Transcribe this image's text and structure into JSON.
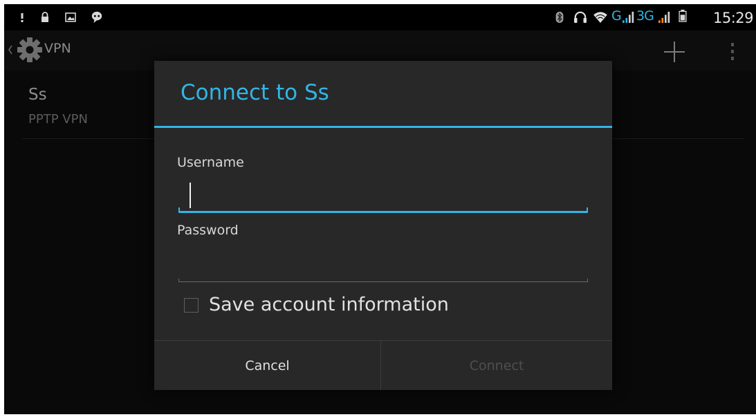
{
  "status_bar": {
    "time": "15:29",
    "network_g": "G",
    "network_3g": "3G",
    "icons": [
      "alert-icon",
      "lock-icon",
      "image-icon",
      "talk-icon",
      "bluetooth-icon",
      "headset-icon",
      "wifi-icon",
      "signal-icon",
      "battery-icon"
    ]
  },
  "action_bar": {
    "title": "VPN"
  },
  "vpn_list": {
    "items": [
      {
        "name": "Ss",
        "type": "PPTP VPN"
      }
    ]
  },
  "dialog": {
    "title": "Connect to Ss",
    "username_label": "Username",
    "username_value": "",
    "password_label": "Password",
    "password_value": "",
    "save_label": "Save account information",
    "save_checked": false,
    "cancel_label": "Cancel",
    "connect_label": "Connect"
  },
  "colors": {
    "accent": "#33b5e5",
    "background": "#0b0b0b",
    "dialog_background": "#282828",
    "disabled_text": "#4f4f4f"
  }
}
